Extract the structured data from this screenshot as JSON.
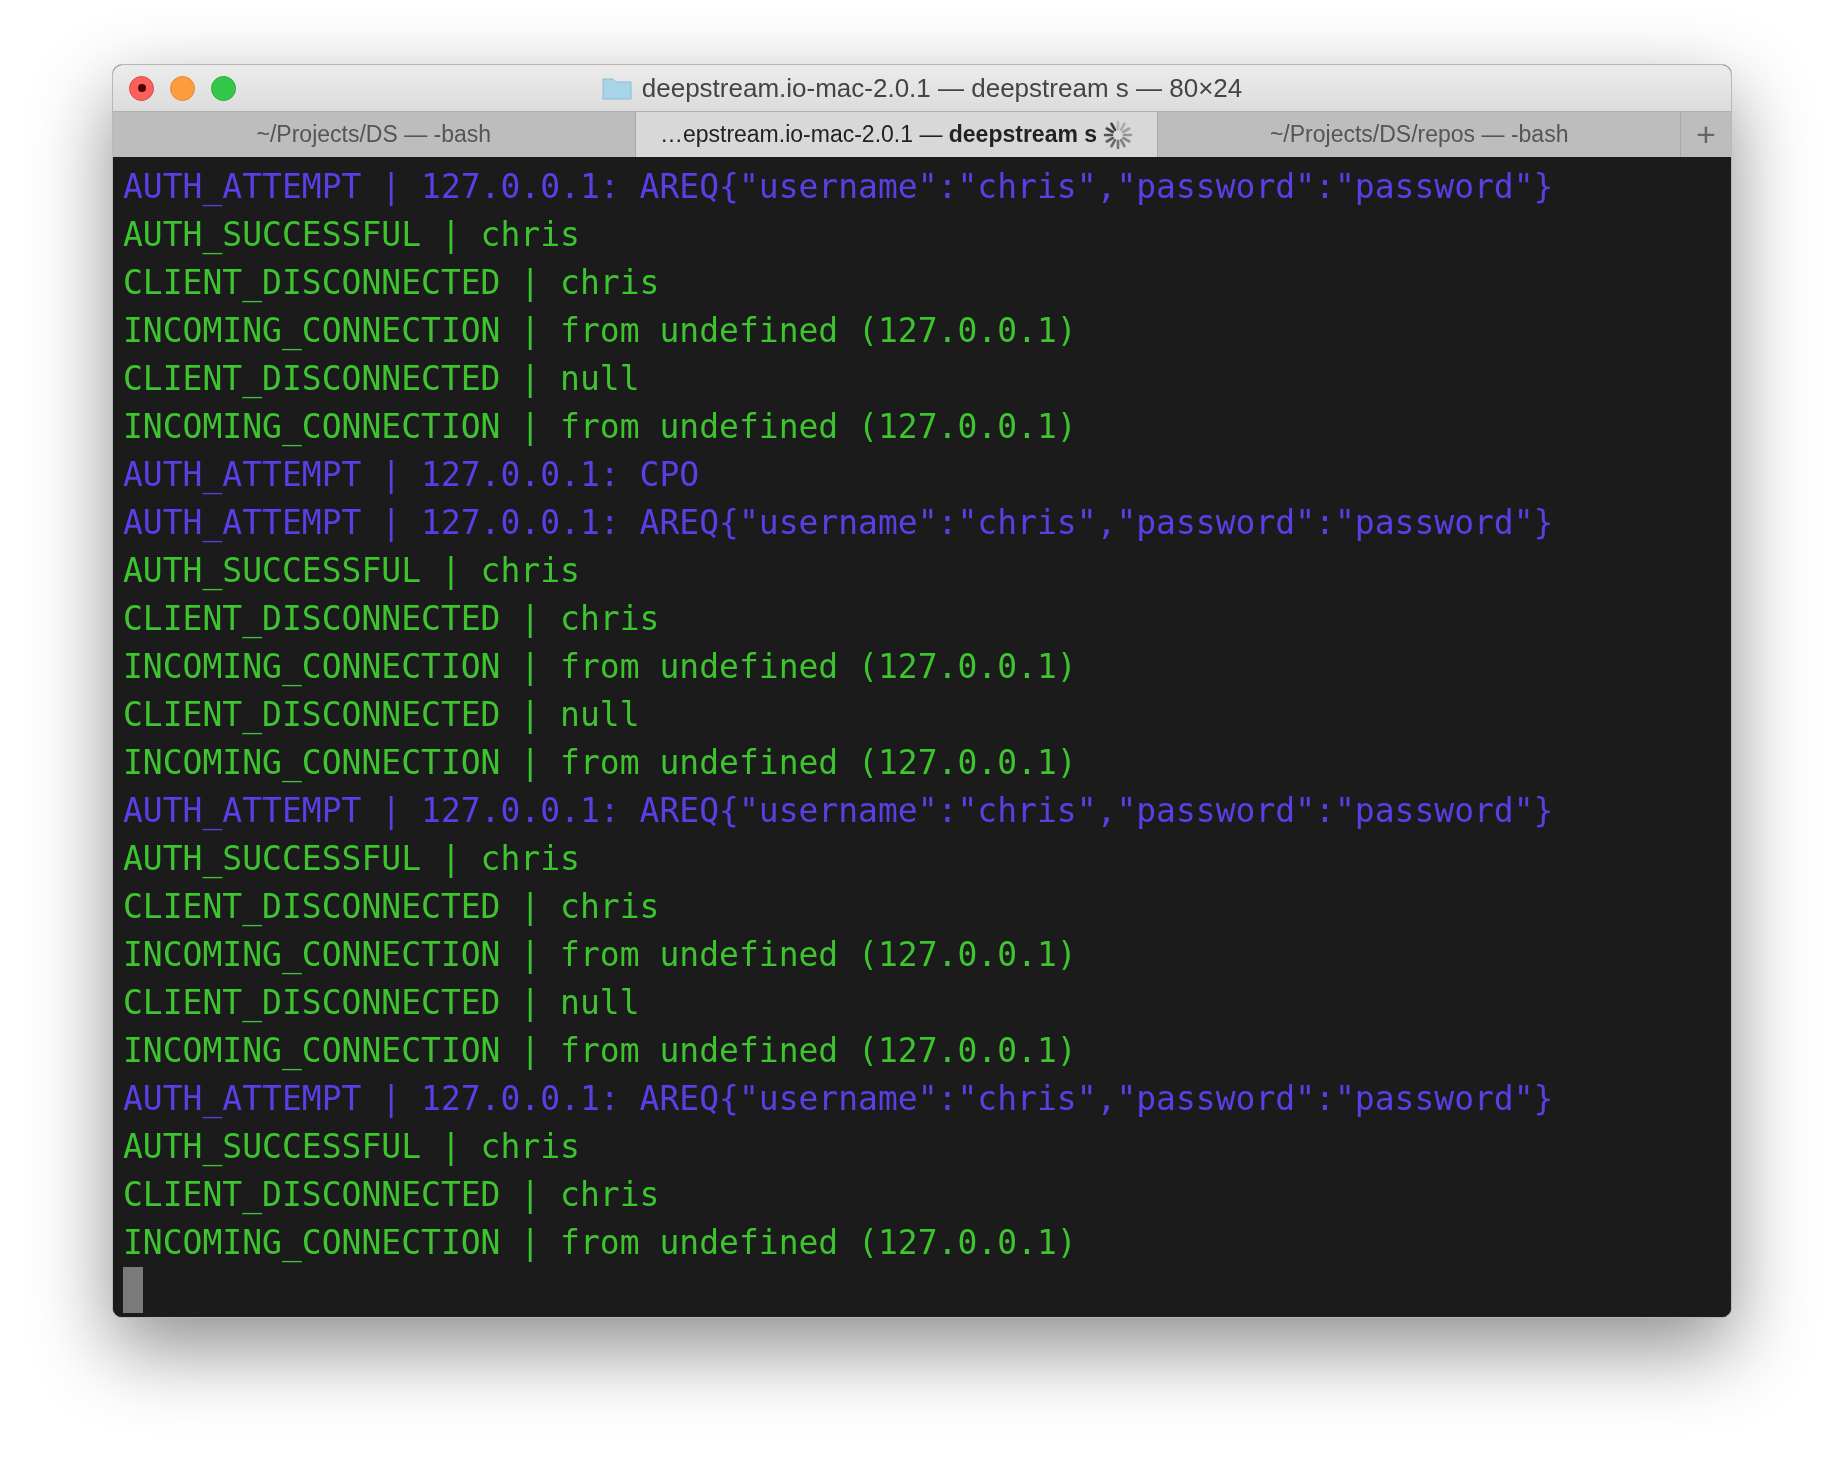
{
  "window": {
    "title": "deepstream.io-mac-2.0.1 — deepstream s — 80×24"
  },
  "tabs": [
    {
      "label": "~/Projects/DS — -bash",
      "selected": false,
      "busy": false
    },
    {
      "label": "…epstream.io-mac-2.0.1 — **deepstream s**",
      "selected": true,
      "busy": true
    },
    {
      "label": "~/Projects/DS/repos — -bash",
      "selected": false,
      "busy": false
    }
  ],
  "new_tab_button": "+",
  "lines": [
    {
      "kind": "attempt",
      "text": "AUTH_ATTEMPT | 127.0.0.1: AREQ{\"username\":\"chris\",\"password\":\"password\"}"
    },
    {
      "kind": "event",
      "text": "AUTH_SUCCESSFUL | chris"
    },
    {
      "kind": "event",
      "text": "CLIENT_DISCONNECTED | chris"
    },
    {
      "kind": "event",
      "text": "INCOMING_CONNECTION | from undefined (127.0.0.1)"
    },
    {
      "kind": "event",
      "text": "CLIENT_DISCONNECTED | null"
    },
    {
      "kind": "event",
      "text": "INCOMING_CONNECTION | from undefined (127.0.0.1)"
    },
    {
      "kind": "attempt",
      "text": "AUTH_ATTEMPT | 127.0.0.1: CPO"
    },
    {
      "kind": "attempt",
      "text": "AUTH_ATTEMPT | 127.0.0.1: AREQ{\"username\":\"chris\",\"password\":\"password\"}"
    },
    {
      "kind": "event",
      "text": "AUTH_SUCCESSFUL | chris"
    },
    {
      "kind": "event",
      "text": "CLIENT_DISCONNECTED | chris"
    },
    {
      "kind": "event",
      "text": "INCOMING_CONNECTION | from undefined (127.0.0.1)"
    },
    {
      "kind": "event",
      "text": "CLIENT_DISCONNECTED | null"
    },
    {
      "kind": "event",
      "text": "INCOMING_CONNECTION | from undefined (127.0.0.1)"
    },
    {
      "kind": "attempt",
      "text": "AUTH_ATTEMPT | 127.0.0.1: AREQ{\"username\":\"chris\",\"password\":\"password\"}"
    },
    {
      "kind": "event",
      "text": "AUTH_SUCCESSFUL | chris"
    },
    {
      "kind": "event",
      "text": "CLIENT_DISCONNECTED | chris"
    },
    {
      "kind": "event",
      "text": "INCOMING_CONNECTION | from undefined (127.0.0.1)"
    },
    {
      "kind": "event",
      "text": "CLIENT_DISCONNECTED | null"
    },
    {
      "kind": "event",
      "text": "INCOMING_CONNECTION | from undefined (127.0.0.1)"
    },
    {
      "kind": "attempt",
      "text": "AUTH_ATTEMPT | 127.0.0.1: AREQ{\"username\":\"chris\",\"password\":\"password\"}"
    },
    {
      "kind": "event",
      "text": "AUTH_SUCCESSFUL | chris"
    },
    {
      "kind": "event",
      "text": "CLIENT_DISCONNECTED | chris"
    },
    {
      "kind": "event",
      "text": "INCOMING_CONNECTION | from undefined (127.0.0.1)"
    }
  ]
}
